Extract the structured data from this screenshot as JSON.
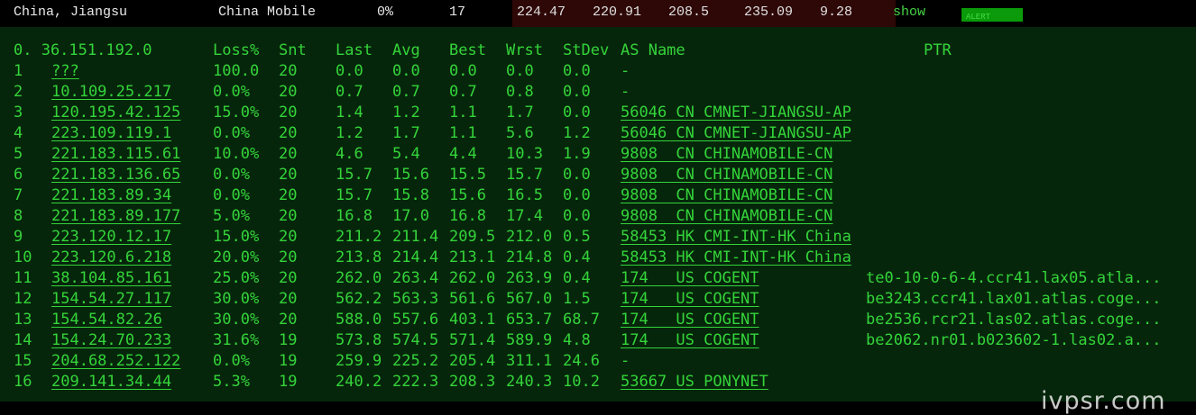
{
  "summary": {
    "location": "China, Jiangsu",
    "isp": "China Mobile",
    "loss": "0%",
    "sent": "17",
    "last": "224.47",
    "avg": "220.91",
    "best": "208.5",
    "worst": "235.09",
    "stdev": "9.28",
    "show_label": "show",
    "bar_text": "ALERT"
  },
  "headers": {
    "host": "0.  36.151.192.0",
    "loss": "Loss%",
    "snt": "Snt",
    "last": "Last",
    "avg": "Avg",
    "best": "Best",
    "wrst": "Wrst",
    "stdev": "StDev",
    "asname": "AS Name",
    "ptr": "PTR"
  },
  "hops": [
    {
      "hop": "1",
      "ip": "???",
      "loss": "100.0",
      "snt": "20",
      "last": "0.0",
      "avg": "0.0",
      "best": "0.0",
      "wrst": "0.0",
      "stdev": "0.0",
      "asname": "-",
      "ptr": ""
    },
    {
      "hop": "2",
      "ip": "10.109.25.217",
      "loss": "0.0%",
      "snt": "20",
      "last": "0.7",
      "avg": "0.7",
      "best": "0.7",
      "wrst": "0.8",
      "stdev": "0.0",
      "asname": "-",
      "ptr": ""
    },
    {
      "hop": "3",
      "ip": "120.195.42.125",
      "loss": "15.0%",
      "snt": "20",
      "last": "1.4",
      "avg": "1.2",
      "best": "1.1",
      "wrst": "1.7",
      "stdev": "0.0",
      "asname": "56046 CN CMNET-JIANGSU-AP",
      "ptr": ""
    },
    {
      "hop": "4",
      "ip": "223.109.119.1",
      "loss": "0.0%",
      "snt": "20",
      "last": "1.2",
      "avg": "1.7",
      "best": "1.1",
      "wrst": "5.6",
      "stdev": "1.2",
      "asname": "56046 CN CMNET-JIANGSU-AP",
      "ptr": ""
    },
    {
      "hop": "5",
      "ip": "221.183.115.61",
      "loss": "10.0%",
      "snt": "20",
      "last": "4.6",
      "avg": "5.4",
      "best": "4.4",
      "wrst": "10.3",
      "stdev": "1.9",
      "asname": "9808  CN CHINAMOBILE-CN",
      "ptr": ""
    },
    {
      "hop": "6",
      "ip": "221.183.136.65",
      "loss": "0.0%",
      "snt": "20",
      "last": "15.7",
      "avg": "15.6",
      "best": "15.5",
      "wrst": "15.7",
      "stdev": "0.0",
      "asname": "9808  CN CHINAMOBILE-CN",
      "ptr": ""
    },
    {
      "hop": "7",
      "ip": "221.183.89.34",
      "loss": "0.0%",
      "snt": "20",
      "last": "15.7",
      "avg": "15.8",
      "best": "15.6",
      "wrst": "16.5",
      "stdev": "0.0",
      "asname": "9808  CN CHINAMOBILE-CN",
      "ptr": ""
    },
    {
      "hop": "8",
      "ip": "221.183.89.177",
      "loss": "5.0%",
      "snt": "20",
      "last": "16.8",
      "avg": "17.0",
      "best": "16.8",
      "wrst": "17.4",
      "stdev": "0.0",
      "asname": "9808  CN CHINAMOBILE-CN",
      "ptr": ""
    },
    {
      "hop": "9",
      "ip": "223.120.12.17",
      "loss": "15.0%",
      "snt": "20",
      "last": "211.2",
      "avg": "211.4",
      "best": "209.5",
      "wrst": "212.0",
      "stdev": "0.5",
      "asname": "58453 HK CMI-INT-HK China",
      "ptr": ""
    },
    {
      "hop": "10",
      "ip": "223.120.6.218",
      "loss": "20.0%",
      "snt": "20",
      "last": "213.8",
      "avg": "214.4",
      "best": "213.1",
      "wrst": "214.8",
      "stdev": "0.4",
      "asname": "58453 HK CMI-INT-HK China",
      "ptr": ""
    },
    {
      "hop": "11",
      "ip": "38.104.85.161",
      "loss": "25.0%",
      "snt": "20",
      "last": "262.0",
      "avg": "263.4",
      "best": "262.0",
      "wrst": "263.9",
      "stdev": "0.4",
      "asname": "174   US COGENT",
      "ptr": "te0-10-0-6-4.ccr41.lax05.atla..."
    },
    {
      "hop": "12",
      "ip": "154.54.27.117",
      "loss": "30.0%",
      "snt": "20",
      "last": "562.2",
      "avg": "563.3",
      "best": "561.6",
      "wrst": "567.0",
      "stdev": "1.5",
      "asname": "174   US COGENT",
      "ptr": "be3243.ccr41.lax01.atlas.coge..."
    },
    {
      "hop": "13",
      "ip": "154.54.82.26",
      "loss": "30.0%",
      "snt": "20",
      "last": "588.0",
      "avg": "557.6",
      "best": "403.1",
      "wrst": "653.7",
      "stdev": "68.7",
      "asname": "174   US COGENT",
      "ptr": "be2536.rcr21.las02.atlas.coge..."
    },
    {
      "hop": "14",
      "ip": "154.24.70.233",
      "loss": "31.6%",
      "snt": "19",
      "last": "573.8",
      "avg": "574.5",
      "best": "571.4",
      "wrst": "589.9",
      "stdev": "4.8",
      "asname": "174   US COGENT",
      "ptr": "be2062.nr01.b023602-1.las02.a..."
    },
    {
      "hop": "15",
      "ip": "204.68.252.122",
      "loss": "0.0%",
      "snt": "19",
      "last": "259.9",
      "avg": "225.2",
      "best": "205.4",
      "wrst": "311.1",
      "stdev": "24.6",
      "asname": "-",
      "ptr": ""
    },
    {
      "hop": "16",
      "ip": "209.141.34.44",
      "loss": "5.3%",
      "snt": "19",
      "last": "240.2",
      "avg": "222.3",
      "best": "208.3",
      "wrst": "240.3",
      "stdev": "10.2",
      "asname": "53667 US PONYNET",
      "ptr": ""
    }
  ],
  "watermark": "ivpsr.com"
}
